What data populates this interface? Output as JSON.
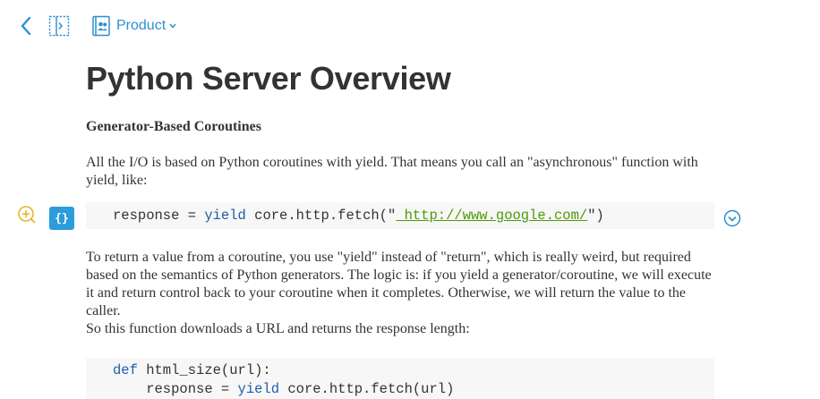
{
  "toolbar": {
    "back_icon": "chevron-left-icon",
    "sidebar_icon": "sidebar-toggle-icon",
    "folder_icon": "shared-folder-icon",
    "folder_label": "Product",
    "accent_color": "#2c8fd1"
  },
  "document": {
    "title": "Python Server Overview",
    "section_heading": "Generator-Based Coroutines",
    "paragraph1": "All the I/O is based on Python coroutines with yield. That means you call an \"asynchronous\" function with yield, like:",
    "code1": {
      "prefix": "response = ",
      "keyword": "yield",
      "call": " core.http.fetch(\"",
      "url": " http://www.google.com/",
      "suffix": "\")"
    },
    "paragraph2": "To return a value from a coroutine, you use \"yield\" instead of \"return\", which is really weird, but required based on the semantics of Python generators. The logic is: if you yield a generator/coroutine, we will execute it and return control back to your coroutine when it completes. Otherwise, we will return the value to the caller.",
    "paragraph3": "So this function downloads a URL and returns the response length:",
    "code2": {
      "line1_kw": "def",
      "line1_rest": " html_size(url):",
      "line2_indent": "    response = ",
      "line2_kw": "yield",
      "line2_rest": " core.http.fetch(url)"
    }
  },
  "gutter": {
    "add_comment_icon": "add-comment-icon",
    "code_block_label": "{}",
    "expand_icon": "chevron-down-circle-icon"
  }
}
